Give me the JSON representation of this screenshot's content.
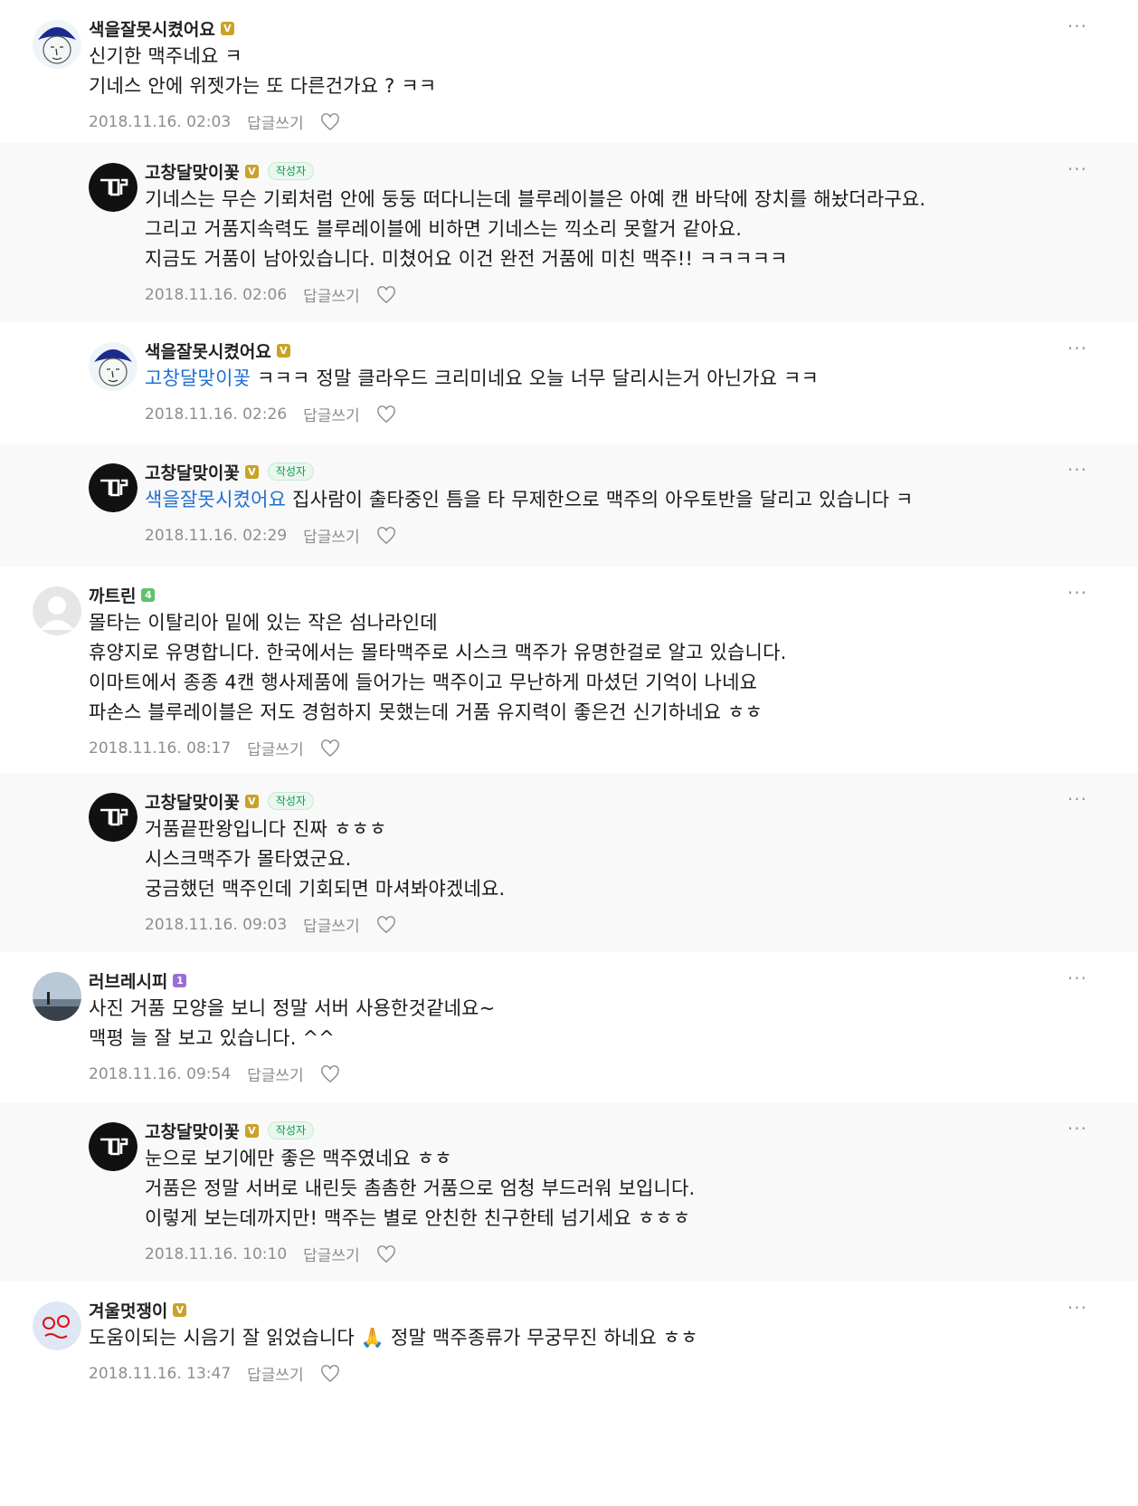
{
  "ui": {
    "reply_label": "답글쓰기",
    "writer_label": "작성자",
    "more_label": "···"
  },
  "colors": {
    "mention": "#1f6fd1",
    "reply_background": "#f9f9f9",
    "writer_tag": "#0a9c4a"
  },
  "comments": [
    {
      "author": "색을잘못시켰어요",
      "badge": "V",
      "is_reply": false,
      "is_writer": false,
      "mention": "",
      "text": "신기한 맥주네요 ㅋ\n기네스 안에 위젯가는 또 다른건가요 ? ㅋㅋ",
      "time": "2018.11.16. 02:03",
      "avatar": "drawing-face-icon"
    },
    {
      "author": "고창달맞이꽃",
      "badge": "V",
      "is_reply": true,
      "is_writer": true,
      "mention": "",
      "text": "기네스는 무슨 기뢰처럼 안에 둥둥 떠다니는데 블루레이블은 아예 캔 바닥에 장치를 해놨더라구요.\n그리고 거품지속력도 블루레이블에 비하면 기네스는 끽소리 못할거 같아요.\n지금도 거품이 남아있습니다. 미쳤어요 이건 완전 거품에 미친 맥주!! ㅋㅋㅋㅋㅋ",
      "time": "2018.11.16. 02:06",
      "avatar": "logo-avatar-icon"
    },
    {
      "author": "색을잘못시켰어요",
      "badge": "V",
      "is_reply": false,
      "is_writer": false,
      "mention": "고창달맞이꽃",
      "text": " ㅋㅋㅋ 정말 클라우드 크리미네요 오늘 너무 달리시는거 아닌가요 ㅋㅋ",
      "time": "2018.11.16. 02:26",
      "avatar": "drawing-face-icon"
    },
    {
      "author": "고창달맞이꽃",
      "badge": "V",
      "is_reply": true,
      "is_writer": true,
      "mention": "색을잘못시켰어요",
      "text": " 집사람이 출타중인 틈을 타 무제한으로 맥주의 아우토반을 달리고 있습니다 ㅋ",
      "time": "2018.11.16. 02:29",
      "avatar": "logo-avatar-icon"
    },
    {
      "author": "까트린",
      "badge": "4",
      "is_reply": false,
      "is_writer": false,
      "mention": "",
      "text": "몰타는 이탈리아 밑에 있는 작은 섬나라인데\n휴양지로 유명합니다. 한국에서는 몰타맥주로 시스크 맥주가 유명한걸로 알고 있습니다.\n이마트에서 종종 4캔 행사제품에 들어가는 맥주이고 무난하게 마셨던 기억이 나네요\n파손스 블루레이블은 저도 경험하지 못했는데 거품 유지력이 좋은건 신기하네요 ㅎㅎ",
      "time": "2018.11.16. 08:17",
      "avatar": "default-avatar-icon"
    },
    {
      "author": "고창달맞이꽃",
      "badge": "V",
      "is_reply": true,
      "is_writer": true,
      "mention": "",
      "text": "거품끝판왕입니다 진짜 ㅎㅎㅎ\n시스크맥주가 몰타였군요.\n궁금했던 맥주인데 기회되면 마셔봐야겠네요.",
      "time": "2018.11.16. 09:03",
      "avatar": "logo-avatar-icon"
    },
    {
      "author": "러브레시피",
      "badge": "1",
      "is_reply": false,
      "is_writer": false,
      "mention": "",
      "text": "사진 거품 모양을 보니 정말 서버 사용한것같네요~\n맥평 늘 잘 보고 있습니다. ^^",
      "time": "2018.11.16. 09:54",
      "avatar": "landscape-photo-icon"
    },
    {
      "author": "고창달맞이꽃",
      "badge": "V",
      "is_reply": true,
      "is_writer": true,
      "mention": "",
      "text": "눈으로 보기에만 좋은 맥주였네요 ㅎㅎ\n거품은 정말 서버로 내린듯 촘촘한 거품으로 엄청 부드러워 보입니다.\n이렇게 보는데까지만! 맥주는 별로 안친한 친구한테 넘기세요 ㅎㅎㅎ",
      "time": "2018.11.16. 10:10",
      "avatar": "logo-avatar-icon"
    },
    {
      "author": "겨울멋쟁이",
      "badge": "V",
      "is_reply": false,
      "is_writer": false,
      "mention": "",
      "text": "도움이되는 시음기 잘 읽었습니다 🙏 정말 맥주종류가 무궁무진 하네요 ㅎㅎ",
      "time": "2018.11.16. 13:47",
      "avatar": "cartoon-face-icon"
    }
  ]
}
